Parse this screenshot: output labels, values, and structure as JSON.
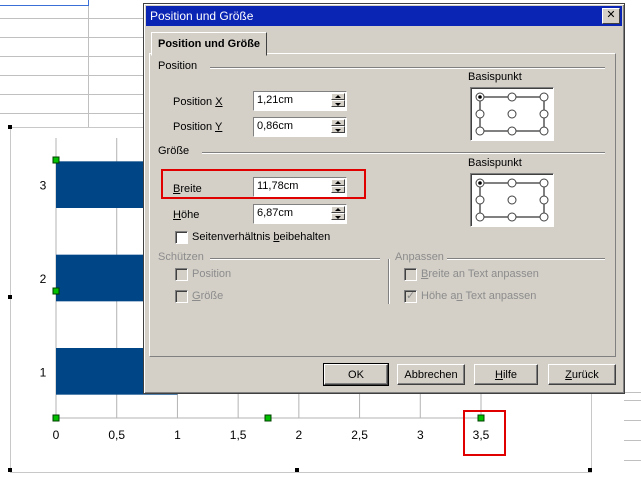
{
  "dialog": {
    "title": "Position und Größe",
    "close_glyph": "✕",
    "tab_label": "Position und Größe",
    "position_group": {
      "title": "Position",
      "x_label_pre": "Position ",
      "x_label_key": "X",
      "x_value": "1,21cm",
      "y_label_pre": "Position ",
      "y_label_key": "Y",
      "y_value": "0,86cm",
      "basis_label": "Basispunkt"
    },
    "size_group": {
      "title": "Größe",
      "width_label_key": "B",
      "width_label_rest": "reite",
      "width_value": "11,78cm",
      "height_label_key": "H",
      "height_label_rest": "öhe",
      "height_value": "6,87cm",
      "keep_ratio_pre": "Seitenverhältnis ",
      "keep_ratio_key": "b",
      "keep_ratio_rest": "eibehalten",
      "basis_label": "Basispunkt"
    },
    "protect_group": {
      "title": "Schützen",
      "position_label": "Position",
      "size_label_key": "G",
      "size_label_rest": "röße"
    },
    "adapt_group": {
      "title": "Anpassen",
      "width_fit_key": "B",
      "width_fit_rest": "reite an Text anpassen",
      "height_fit_pre": "Höhe a",
      "height_fit_key": "n",
      "height_fit_rest": " Text anpassen"
    },
    "buttons": {
      "ok": "OK",
      "cancel": "Abbrechen",
      "help_key": "H",
      "help_rest": "ilfe",
      "reset_key": "Z",
      "reset_rest": "urück"
    }
  },
  "chart_data": {
    "type": "bar",
    "orientation": "horizontal",
    "categories": [
      "1",
      "2",
      "3"
    ],
    "values": [
      1,
      1,
      1
    ],
    "x_ticks": [
      "0",
      "0,5",
      "1",
      "1,5",
      "2",
      "2,5",
      "3",
      "3,5"
    ],
    "xlim": [
      0,
      3.5
    ],
    "bar_color": "#004586",
    "grid": true
  },
  "colors": {
    "title_bar": "#0a24b3",
    "dialog_face": "#d4d0c8",
    "highlight_box": "#e00000",
    "selection_handle": "#00c000"
  }
}
